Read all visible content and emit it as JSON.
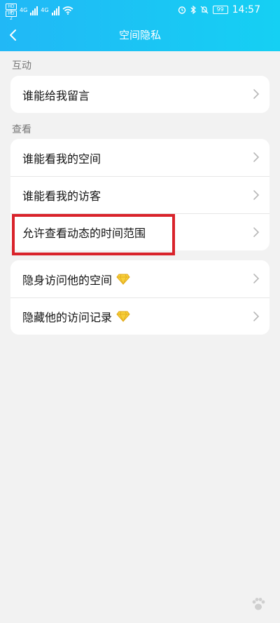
{
  "status_bar": {
    "sim1": "HD 1",
    "sim2": "HD 2",
    "network1": "4G",
    "network2": "4G",
    "battery": "99",
    "time": "14:57"
  },
  "nav": {
    "title": "空间隐私",
    "back_icon": "chevron-left-icon"
  },
  "sections": [
    {
      "label": "互动",
      "items": [
        {
          "label": "谁能给我留言",
          "vip": false
        }
      ]
    },
    {
      "label": "查看",
      "items": [
        {
          "label": "谁能看我的空间",
          "vip": false
        },
        {
          "label": "谁能看我的访客",
          "vip": false
        },
        {
          "label": "允许查看动态的时间范围",
          "vip": false
        }
      ]
    },
    {
      "label": "",
      "items": [
        {
          "label": "隐身访问他的空间",
          "vip": true
        },
        {
          "label": "隐藏他的访问记录",
          "vip": true
        }
      ]
    }
  ],
  "annotation": {
    "highlight_color": "#d9232b"
  },
  "theme": {
    "header_start": "#21b8f6",
    "header_end": "#15d0f3",
    "vip_icon": "diamond-icon"
  }
}
